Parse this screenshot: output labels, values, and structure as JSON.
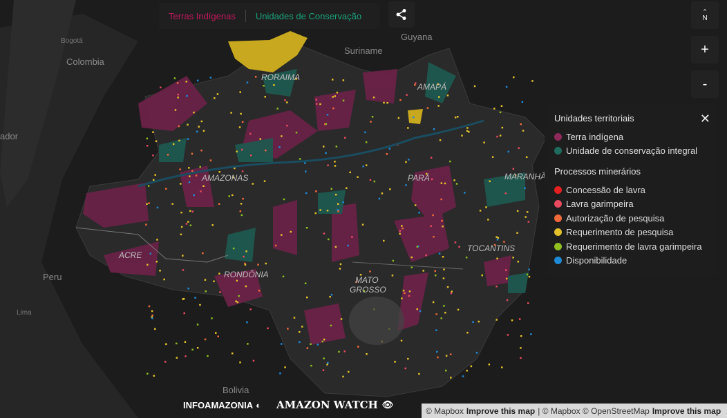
{
  "tabs": {
    "terras_indigenas": "Terras Indígenas",
    "unidades_conservacao": "Unidades de Conservação"
  },
  "controls": {
    "north": "N",
    "zoom_in": "+",
    "zoom_out": "-"
  },
  "legend": {
    "title1": "Unidades territoriais",
    "territorial": [
      {
        "label": "Terra indígena",
        "color": "#8e2a5a"
      },
      {
        "label": "Unidade de conservação integral",
        "color": "#1f6b5e"
      }
    ],
    "title2": "Processos minerários",
    "mining": [
      {
        "label": "Concessão de lavra",
        "color": "#e62020"
      },
      {
        "label": "Lavra garimpeira",
        "color": "#e84a5f"
      },
      {
        "label": "Autorização de pesquisa",
        "color": "#f06a3a"
      },
      {
        "label": "Requerimento de pesquisa",
        "color": "#e2c12a"
      },
      {
        "label": "Requerimento de lavra garimpeira",
        "color": "#8fbf20"
      },
      {
        "label": "Disponibilidade",
        "color": "#1e8ad6"
      }
    ]
  },
  "map_labels": {
    "colombia": "Colombia",
    "guyana": "Guyana",
    "suriname": "Suriname",
    "roraima": "RORAIMA",
    "amapa": "AMAPÁ",
    "amazonas": "AMAZONAS",
    "para": "PARÁ",
    "maranhao": "MARANHÃO",
    "tocantins": "TOCANTINS",
    "acre": "ACRE",
    "rondonia": "RONDÔNIA",
    "mato": "MATO",
    "grosso": "GROSSO",
    "peru": "Peru",
    "bolivia": "Bolivia",
    "ador": "ador",
    "lima": "Lima",
    "bogota": "Bogotá"
  },
  "logos": {
    "infoamazonia": "INFOAMAZONIA",
    "amazon_watch": "AMAZON WATCH"
  },
  "attribution": {
    "mapbox1": "© Mapbox",
    "improve1": "Improve this map",
    "mapbox2": "© Mapbox",
    "osm": "© OpenStreetMap",
    "improve2": "Improve this map"
  }
}
